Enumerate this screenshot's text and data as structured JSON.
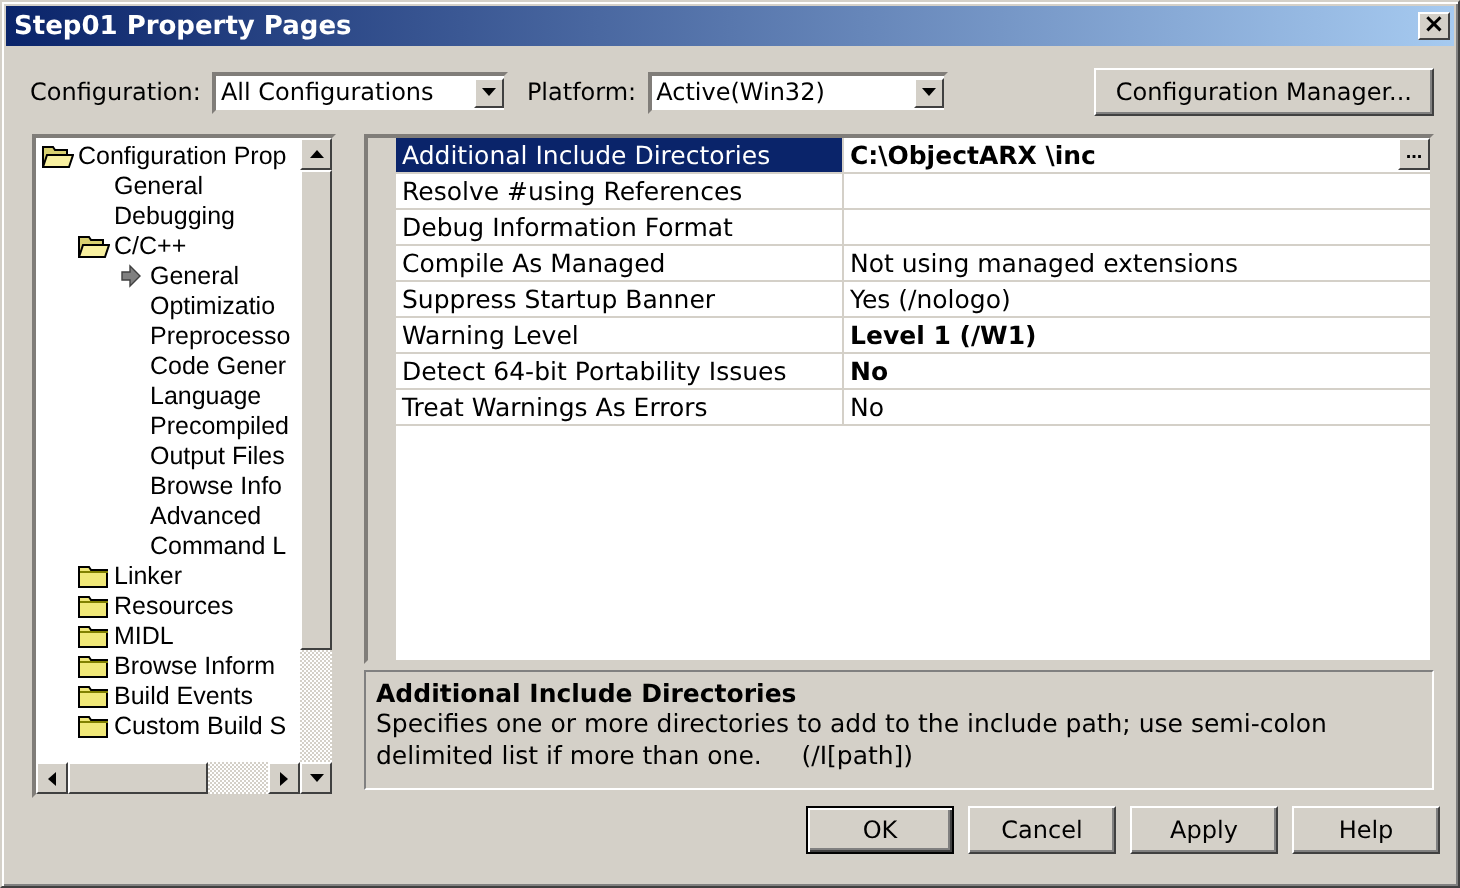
{
  "window": {
    "title": "Step01 Property Pages",
    "close": "×"
  },
  "toolbar": {
    "configuration_label": "Configuration:",
    "configuration_value": "All Configurations",
    "platform_label": "Platform:",
    "platform_value": "Active(Win32)",
    "manager_button": "Configuration Manager..."
  },
  "tree": [
    {
      "label": "Configuration Prop",
      "kind": "open-folder",
      "selected": false,
      "children": [
        {
          "label": "General",
          "kind": "leaf",
          "selected": false
        },
        {
          "label": "Debugging",
          "kind": "leaf",
          "selected": false
        },
        {
          "label": "C/C++",
          "kind": "open-folder",
          "selected": false,
          "children": [
            {
              "label": "General",
              "kind": "current",
              "selected": false
            },
            {
              "label": "Optimizatio",
              "kind": "leaf",
              "selected": false
            },
            {
              "label": "Preprocesso",
              "kind": "leaf",
              "selected": false
            },
            {
              "label": "Code Gener",
              "kind": "leaf",
              "selected": false
            },
            {
              "label": "Language",
              "kind": "leaf",
              "selected": false
            },
            {
              "label": "Precompiled",
              "kind": "leaf",
              "selected": false
            },
            {
              "label": "Output Files",
              "kind": "leaf",
              "selected": false
            },
            {
              "label": "Browse Info",
              "kind": "leaf",
              "selected": false
            },
            {
              "label": "Advanced",
              "kind": "leaf",
              "selected": false
            },
            {
              "label": "Command L",
              "kind": "leaf",
              "selected": false
            }
          ]
        },
        {
          "label": "Linker",
          "kind": "folder",
          "selected": false
        },
        {
          "label": "Resources",
          "kind": "folder",
          "selected": false
        },
        {
          "label": "MIDL",
          "kind": "folder",
          "selected": false
        },
        {
          "label": "Browse Inform",
          "kind": "folder",
          "selected": false
        },
        {
          "label": "Build Events",
          "kind": "folder",
          "selected": false
        },
        {
          "label": "Custom Build S",
          "kind": "folder",
          "selected": false
        }
      ]
    }
  ],
  "properties": [
    {
      "name": "Additional Include Directories",
      "value": "C:\\ObjectARX \\inc",
      "bold": true,
      "selected": true,
      "browse": "..."
    },
    {
      "name": "Resolve #using References",
      "selected": false
    },
    {
      "name": "Debug Information Format",
      "selected": false
    },
    {
      "name": "Compile As Managed",
      "value": "Not using managed extensions",
      "bold": false,
      "selected": false
    },
    {
      "name": "Suppress Startup Banner",
      "value": "Yes (/nologo)",
      "bold": false,
      "selected": false
    },
    {
      "name": "Warning Level",
      "value": "Level 1 (/W1)",
      "bold": true,
      "selected": false
    },
    {
      "name": "Detect 64-bit Portability Issues",
      "value": "No",
      "bold": true,
      "selected": false
    },
    {
      "name": "Treat Warnings As Errors",
      "value": "No",
      "bold": false,
      "selected": false
    }
  ],
  "description": {
    "title": "Additional Include Directories",
    "text": "Specifies one or more directories to add to the include path; use semi-colon delimited list if more than one.     (/I[path])"
  },
  "buttons": [
    {
      "label": "OK",
      "default": true
    },
    {
      "label": "Cancel",
      "default": false
    },
    {
      "label": "Apply",
      "default": false
    },
    {
      "label": "Help",
      "default": false
    }
  ]
}
